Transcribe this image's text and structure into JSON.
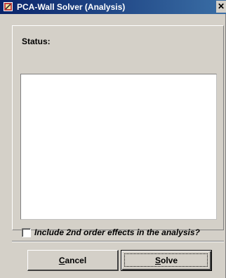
{
  "window": {
    "title": "PCA-Wall Solver (Analysis)",
    "close_glyph": "✕",
    "title_icon": "app-icon",
    "titlebar_colors": [
      "#0a246a",
      "#3a6ea5"
    ]
  },
  "status": {
    "label": "Status:",
    "text": ""
  },
  "option": {
    "label": "Include 2nd order effects in the analysis?",
    "checked": false
  },
  "buttons": {
    "cancel": {
      "mnemonic": "C",
      "rest": "ancel"
    },
    "solve": {
      "mnemonic": "S",
      "rest": "olve"
    }
  }
}
